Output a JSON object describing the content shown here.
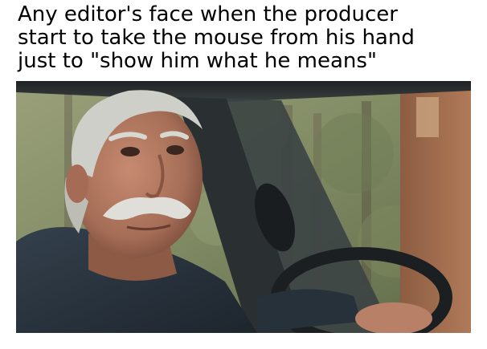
{
  "caption": {
    "lines": [
      "Any editor's face when the producer",
      "start to take the mouse from his hand",
      "just to \"show him what he means\""
    ]
  },
  "photo": {
    "subject": "older man with white mustache in driver's seat of a car, glancing over his shoulder",
    "colors": {
      "forest": "#7f8a63",
      "skin": "#b77e66",
      "hair": "#cfcfc9",
      "shirt": "#2b3540",
      "door_trim": "#9a6a4c"
    }
  }
}
